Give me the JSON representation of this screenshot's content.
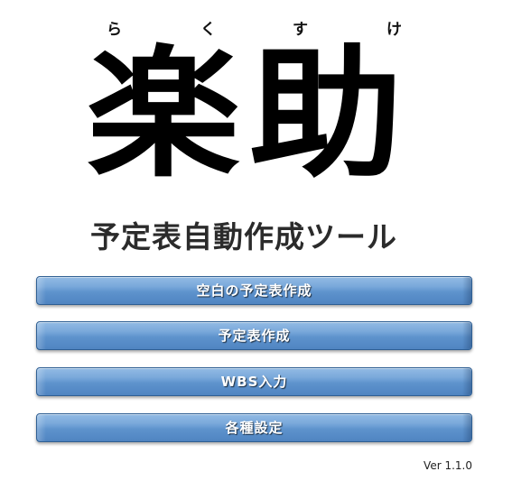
{
  "logo": {
    "ruby": [
      "ら",
      "く",
      "す",
      "け"
    ],
    "title": "楽助",
    "subtitle": "予定表自動作成ツール"
  },
  "menu": {
    "buttons": [
      {
        "label": "空白の予定表作成"
      },
      {
        "label": "予定表作成"
      },
      {
        "label": "WBS入力"
      },
      {
        "label": "各種設定"
      }
    ]
  },
  "footer": {
    "version": "Ver 1.1.0"
  },
  "colors": {
    "button_top": "#93bbe4",
    "button_bottom": "#4f84c1",
    "button_border": "#2f5f93",
    "button_text": "#ffffff"
  }
}
